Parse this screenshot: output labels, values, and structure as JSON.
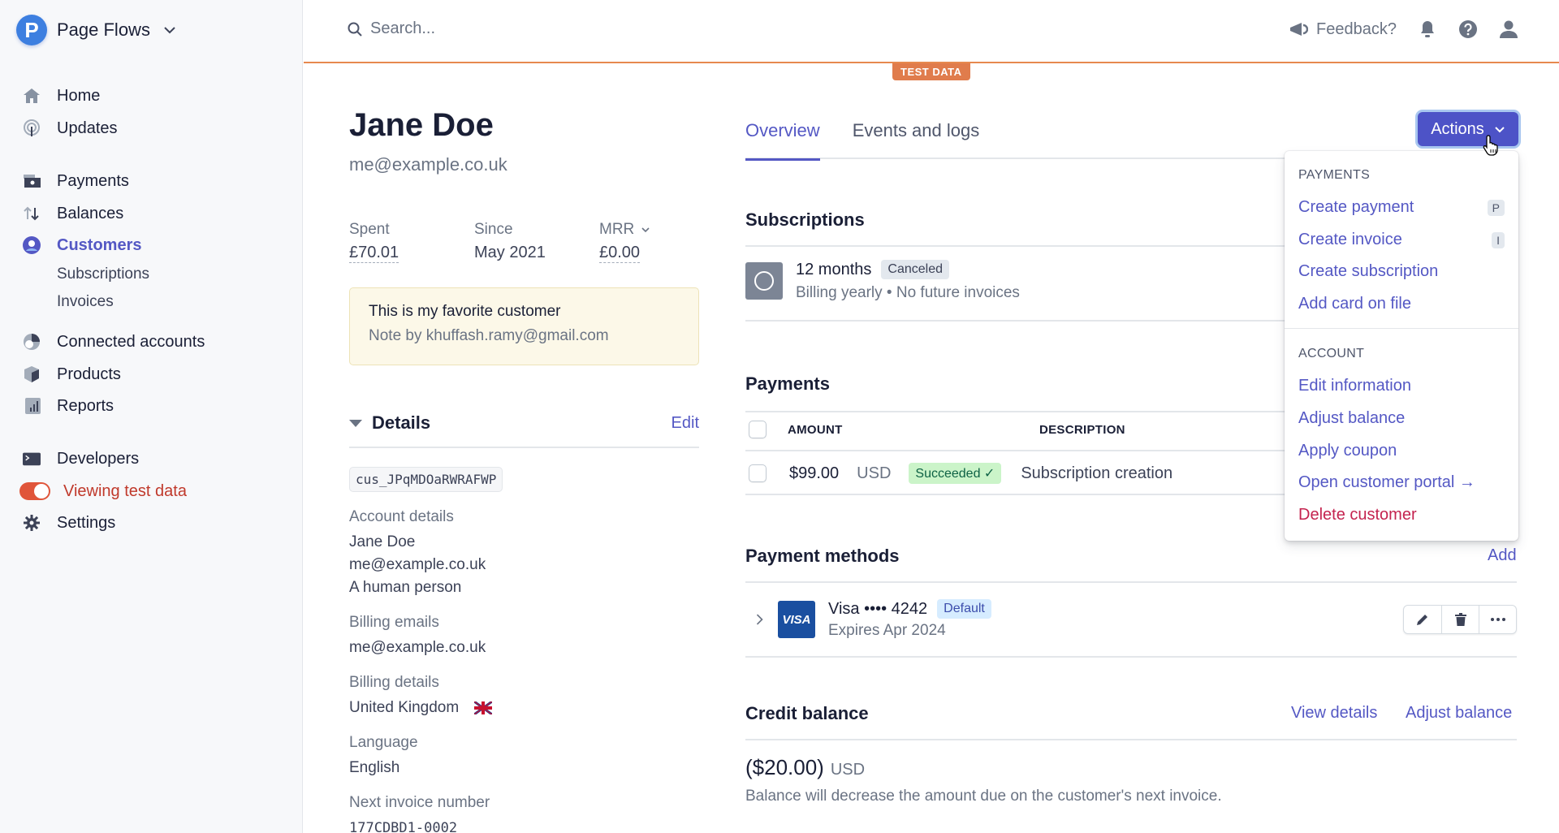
{
  "brand": {
    "name": "Page Flows",
    "logo_letter": "P"
  },
  "sidebar": {
    "items": [
      {
        "label": "Home",
        "icon": "home-icon"
      },
      {
        "label": "Updates",
        "icon": "broadcast-icon"
      },
      {
        "label": "Payments",
        "icon": "payments-icon"
      },
      {
        "label": "Balances",
        "icon": "balances-icon"
      },
      {
        "label": "Customers",
        "icon": "customers-icon",
        "active": true
      },
      {
        "label": "Connected accounts",
        "icon": "connected-accounts-icon"
      },
      {
        "label": "Products",
        "icon": "products-icon"
      },
      {
        "label": "Reports",
        "icon": "reports-icon"
      },
      {
        "label": "Developers",
        "icon": "terminal-icon"
      },
      {
        "label": "Viewing test data",
        "icon": "toggle-icon"
      },
      {
        "label": "Settings",
        "icon": "gear-icon"
      }
    ],
    "sub_items": [
      {
        "label": "Subscriptions"
      },
      {
        "label": "Invoices"
      }
    ],
    "test_mode_on": true
  },
  "topbar": {
    "search_placeholder": "Search...",
    "feedback_label": "Feedback?",
    "test_badge": "TEST DATA",
    "accent_color": "#e7894f"
  },
  "customer": {
    "name": "Jane Doe",
    "email": "me@example.co.uk",
    "stats": [
      {
        "label": "Spent",
        "value": "£70.01"
      },
      {
        "label": "Since",
        "value": "May 2021"
      },
      {
        "label": "MRR",
        "value": "£0.00"
      }
    ],
    "note": {
      "text": "This is my favorite customer",
      "by": "Note by khuffash.ramy@gmail.com"
    },
    "details": {
      "title": "Details",
      "edit_label": "Edit",
      "id": "cus_JPqMDOaRWRAFWP",
      "account_label": "Account details",
      "account_lines": [
        "Jane Doe",
        "me@example.co.uk",
        "A human person"
      ],
      "billing_emails_label": "Billing emails",
      "billing_emails": "me@example.co.uk",
      "billing_details_label": "Billing details",
      "billing_country": "United Kingdom",
      "language_label": "Language",
      "language": "English",
      "next_invoice_label": "Next invoice number",
      "next_invoice": "177CDBD1-0002"
    }
  },
  "tabs": [
    {
      "label": "Overview",
      "active": true
    },
    {
      "label": "Events and logs"
    }
  ],
  "actions": {
    "button_label": "Actions",
    "groups": [
      {
        "label": "PAYMENTS",
        "items": [
          {
            "label": "Create payment",
            "shortcut": "P"
          },
          {
            "label": "Create invoice",
            "shortcut": "I"
          },
          {
            "label": "Create subscription"
          },
          {
            "label": "Add card on file"
          }
        ]
      },
      {
        "label": "ACCOUNT",
        "items": [
          {
            "label": "Edit information"
          },
          {
            "label": "Adjust balance"
          },
          {
            "label": "Apply coupon"
          },
          {
            "label": "Open customer portal →"
          },
          {
            "label": "Delete customer",
            "danger": true
          }
        ]
      }
    ]
  },
  "subscriptions": {
    "title": "Subscriptions",
    "items": [
      {
        "name": "12 months",
        "status": "Canceled",
        "meta": "Billing yearly • No future invoices"
      }
    ]
  },
  "payments": {
    "title": "Payments",
    "columns": [
      "AMOUNT",
      "DESCRIPTION"
    ],
    "rows": [
      {
        "amount": "$99.00",
        "currency": "USD",
        "status": "Succeeded ✓",
        "description": "Subscription creation"
      }
    ]
  },
  "payment_methods": {
    "title": "Payment methods",
    "add_label": "Add",
    "items": [
      {
        "brand": "VISA",
        "title": "Visa •••• 4242",
        "badge": "Default",
        "expires": "Expires Apr 2024"
      }
    ]
  },
  "credit_balance": {
    "title": "Credit balance",
    "view_details": "View details",
    "adjust_balance": "Adjust balance",
    "amount": "($20.00)",
    "currency": "USD",
    "note": "Balance will decrease the amount due on the customer's next invoice."
  }
}
